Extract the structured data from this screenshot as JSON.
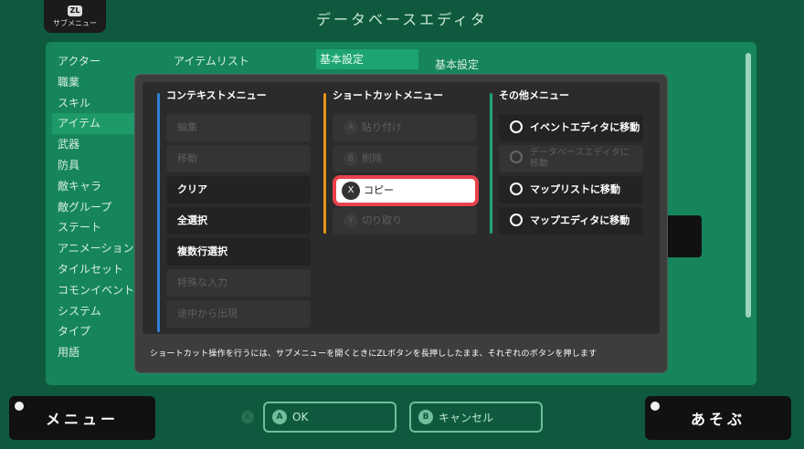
{
  "top": {
    "submenu_key": "ZL",
    "submenu_label": "サブメニュー",
    "title": "データベースエディタ"
  },
  "background": {
    "list": [
      "アクター",
      "職業",
      "スキル",
      "アイテム",
      "武器",
      "防具",
      "敵キャラ",
      "敵グループ",
      "ステート",
      "アニメーション",
      "タイルセット",
      "コモンイベント",
      "システム",
      "タイプ",
      "用語"
    ],
    "active_index": 3,
    "col2_header": "アイテムリスト",
    "tab_label": "基本設定",
    "col3_header": "基本設定"
  },
  "modal": {
    "columns": [
      {
        "title": "コンテキストメニュー",
        "color": "#2f7fd8",
        "items": [
          {
            "label": "編集",
            "enabled": false,
            "key": ""
          },
          {
            "label": "移動",
            "enabled": false,
            "key": ""
          },
          {
            "label": "クリア",
            "enabled": true,
            "key": ""
          },
          {
            "label": "全選択",
            "enabled": true,
            "key": ""
          },
          {
            "label": "複数行選択",
            "enabled": true,
            "key": ""
          },
          {
            "label": "特殊な入力",
            "enabled": false,
            "key": ""
          },
          {
            "label": "途中から出現",
            "enabled": false,
            "key": ""
          }
        ]
      },
      {
        "title": "ショートカットメニュー",
        "color": "#e8941c",
        "items": [
          {
            "label": "貼り付け",
            "enabled": false,
            "key": "A"
          },
          {
            "label": "削除",
            "enabled": false,
            "key": "B"
          },
          {
            "label": "コピー",
            "enabled": true,
            "key": "X",
            "selected": true
          },
          {
            "label": "切り取り",
            "enabled": false,
            "key": "Y"
          }
        ]
      },
      {
        "title": "その他メニュー",
        "color": "#1fa37a",
        "items": [
          {
            "label": "イベントエディタに移動",
            "enabled": true,
            "icon": "event-editor-icon"
          },
          {
            "label": "データベースエディタに移動",
            "enabled": false,
            "icon": "database-editor-icon"
          },
          {
            "label": "マップリストに移動",
            "enabled": true,
            "icon": "map-list-icon"
          },
          {
            "label": "マップエディタに移動",
            "enabled": true,
            "icon": "map-editor-icon"
          }
        ]
      }
    ],
    "hint": "ショートカット操作を行うには、サブメニューを開くときにZLボタンを長押ししたまま、それぞれのボタンを押します"
  },
  "bottom": {
    "menu_label": "メニュー",
    "x_key": "X",
    "ok_key": "A",
    "ok_label": "OK",
    "cancel_key": "B",
    "cancel_label": "キャンセル",
    "play_label": "あそぶ"
  }
}
